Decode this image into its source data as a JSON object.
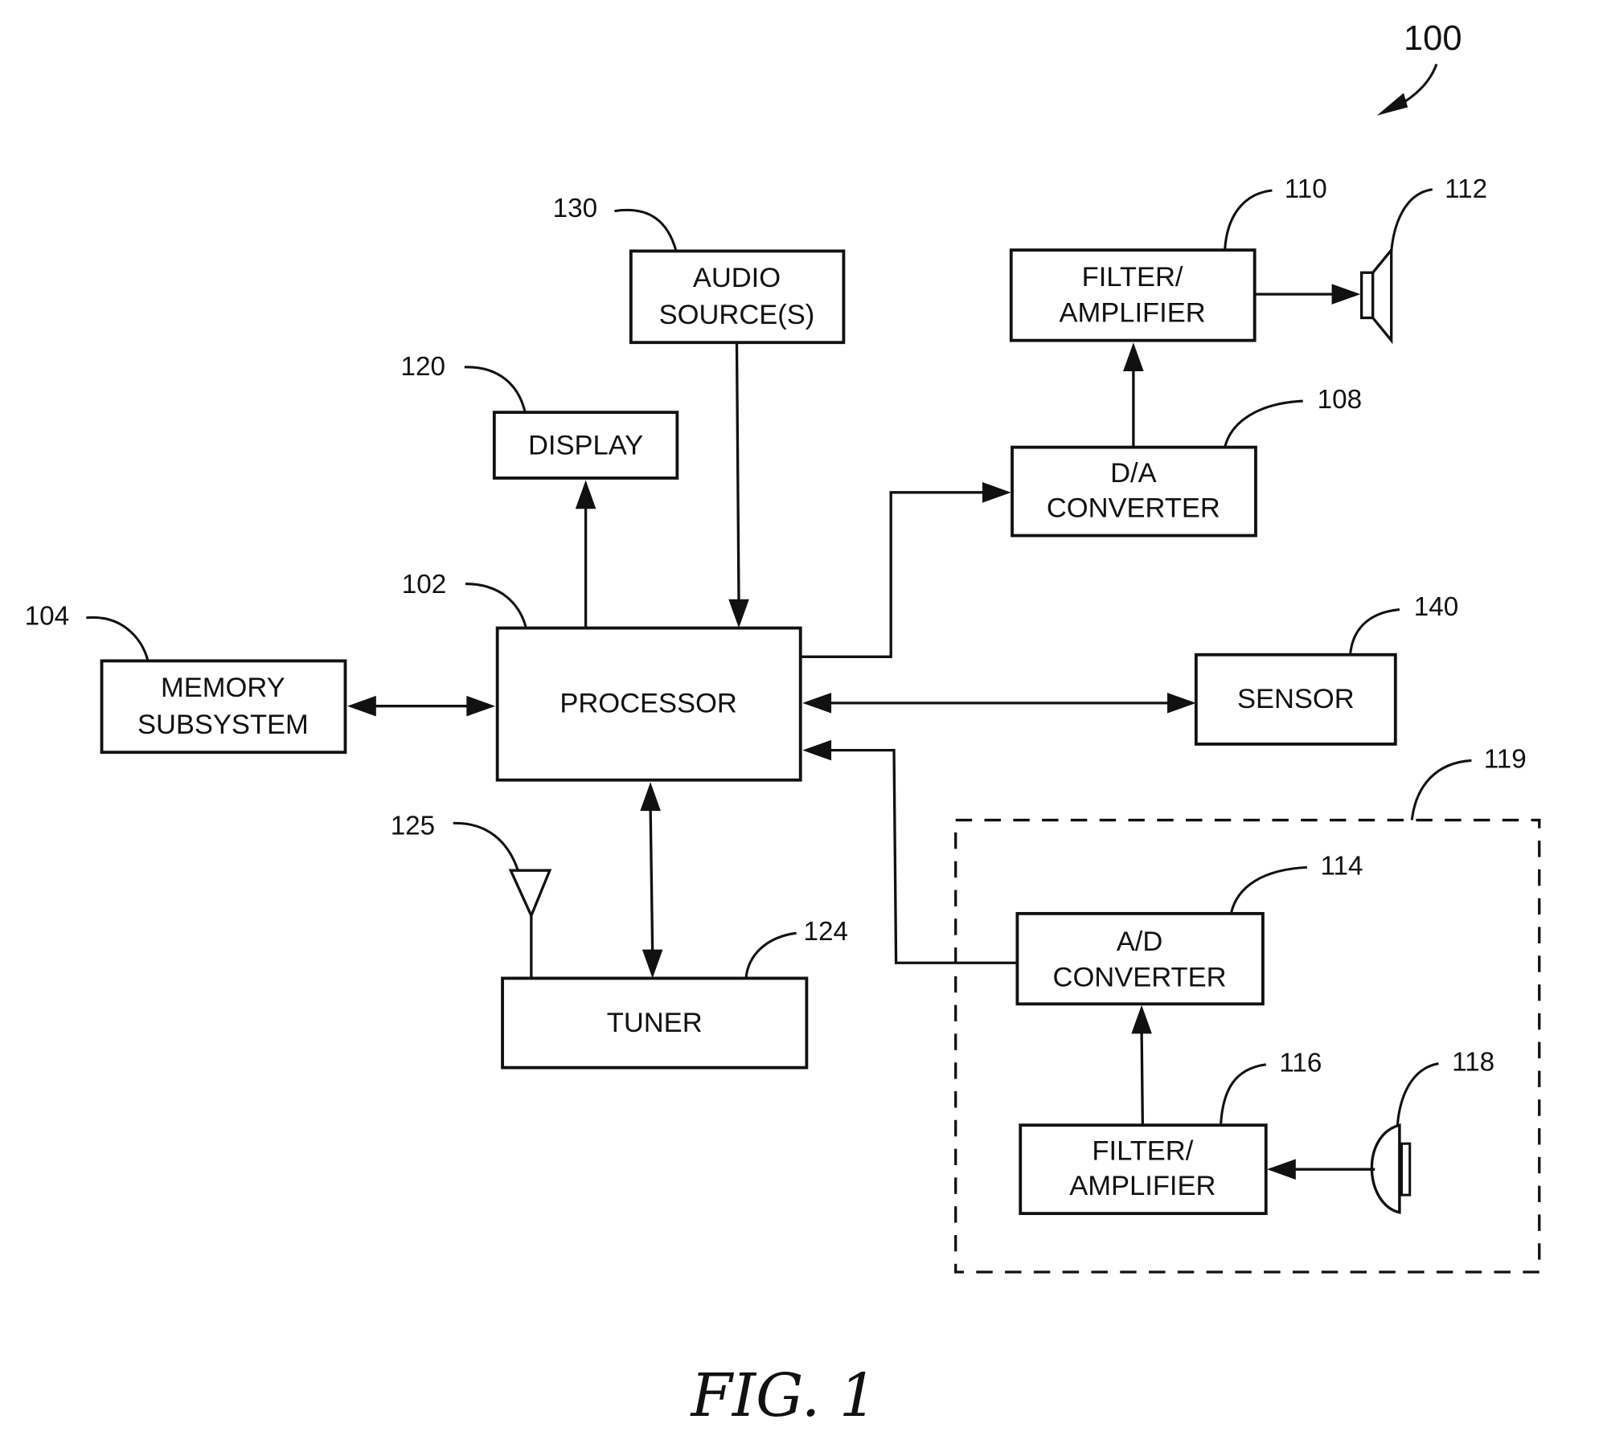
{
  "figure": {
    "caption": "FIG. 1",
    "system_ref": "100"
  },
  "blocks": {
    "audio_source": {
      "ref": "130",
      "line1": "AUDIO",
      "line2": "SOURCE(S)"
    },
    "display": {
      "ref": "120",
      "label": "DISPLAY"
    },
    "processor": {
      "ref": "102",
      "label": "PROCESSOR"
    },
    "memory": {
      "ref": "104",
      "line1": "MEMORY",
      "line2": "SUBSYSTEM"
    },
    "tuner": {
      "ref": "124",
      "label": "TUNER"
    },
    "antenna": {
      "ref": "125"
    },
    "filter_amp_out": {
      "ref": "110",
      "line1": "FILTER/",
      "line2": "AMPLIFIER"
    },
    "speaker": {
      "ref": "112"
    },
    "da_converter": {
      "ref": "108",
      "line1": "D/A",
      "line2": "CONVERTER"
    },
    "sensor": {
      "ref": "140",
      "label": "SENSOR"
    },
    "input_group": {
      "ref": "119"
    },
    "ad_converter": {
      "ref": "114",
      "line1": "A/D",
      "line2": "CONVERTER"
    },
    "filter_amp_in": {
      "ref": "116",
      "line1": "FILTER/",
      "line2": "AMPLIFIER"
    },
    "microphone": {
      "ref": "118"
    }
  }
}
